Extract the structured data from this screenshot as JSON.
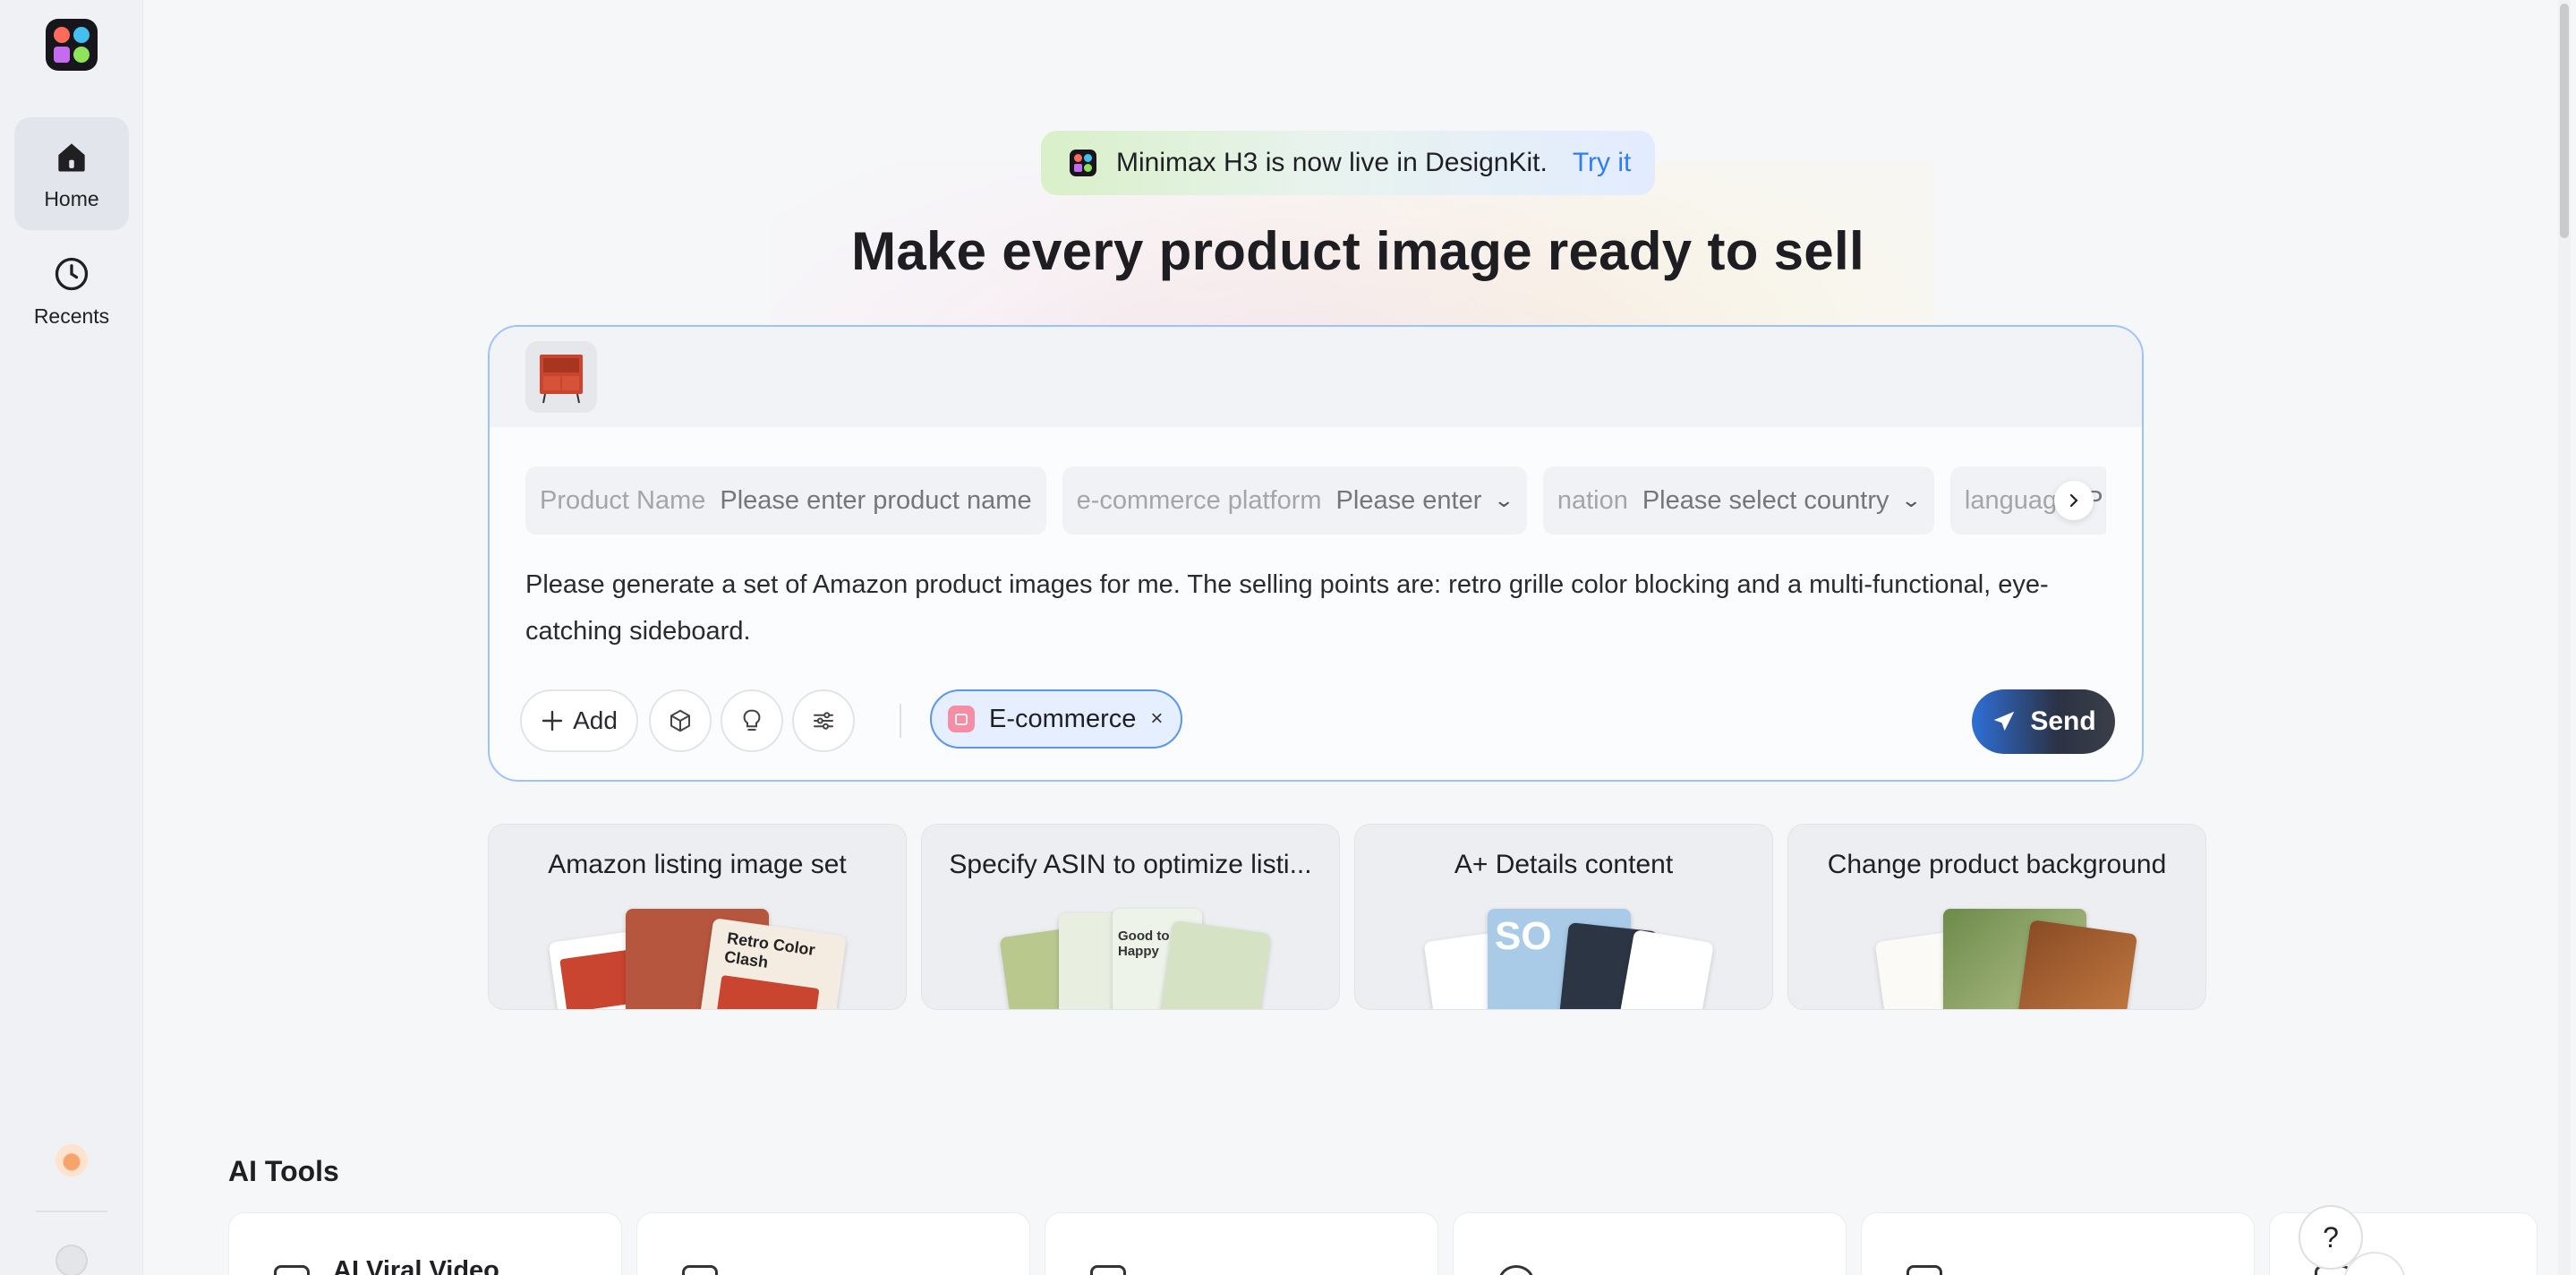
{
  "sidebar": {
    "items": [
      {
        "label": "Home",
        "icon": "home-icon",
        "active": true
      },
      {
        "label": "Recents",
        "icon": "clock-icon",
        "active": false
      }
    ]
  },
  "announcement": {
    "text": "Minimax H3 is now live in DesignKit.",
    "link": "Try it"
  },
  "headline": "Make every product image ready to sell",
  "composer": {
    "fields": [
      {
        "label": "Product Name",
        "placeholder": "Please enter product name",
        "dropdown": false
      },
      {
        "label": "e-commerce platform",
        "placeholder": "Please enter",
        "dropdown": true
      },
      {
        "label": "nation",
        "placeholder": "Please select country",
        "dropdown": true
      },
      {
        "label": "language",
        "placeholder": "P",
        "dropdown": false
      }
    ],
    "prompt": "Please generate a set of Amazon product images for me. The selling points are: retro grille color blocking and a multi-functional, eye-catching sideboard.",
    "add_label": "Add",
    "tag_label": "E-commerce",
    "tag_close": "×",
    "send_label": "Send"
  },
  "cards": [
    {
      "title": "Amazon listing image set",
      "art_text": "Retro Color Clash"
    },
    {
      "title": "Specify ASIN to optimize listi...",
      "art_text": "Good to Happy"
    },
    {
      "title": "A+ Details content",
      "art_text": "SO"
    },
    {
      "title": "Change product background",
      "art_text": ""
    }
  ],
  "ai_tools": {
    "title": "AI Tools",
    "items": [
      {
        "label": "AI Viral Video"
      },
      {
        "label": ""
      },
      {
        "label": ""
      },
      {
        "label": ""
      },
      {
        "label": ""
      }
    ]
  },
  "help_label": "?",
  "colors": {
    "accent": "#2f7cf6",
    "composer_border": "#9cc3ff",
    "tag_border": "#5a95ef",
    "send_dark": "#2b3244"
  }
}
